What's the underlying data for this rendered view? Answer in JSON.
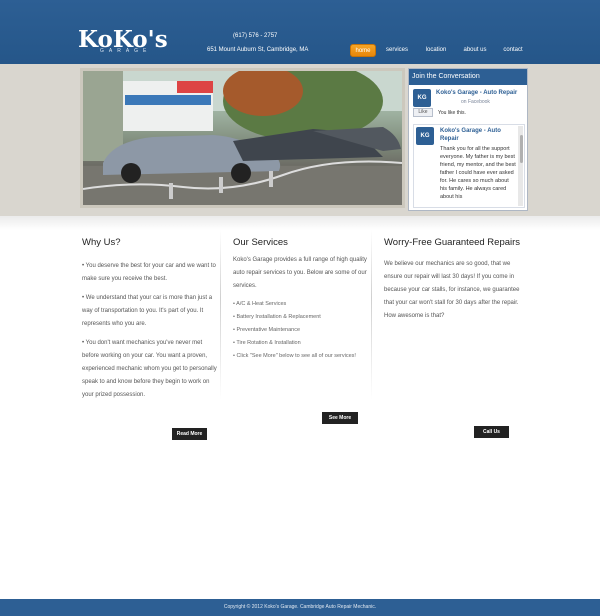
{
  "header": {
    "logo": "KoKo's",
    "logo_sub": "GARAGE",
    "phone": "(617) 576 - 2757",
    "address": "651 Mount Auburn St, Cambridge, MA",
    "nav": [
      {
        "label": "home",
        "active": true
      },
      {
        "label": "services",
        "active": false
      },
      {
        "label": "location",
        "active": false
      },
      {
        "label": "about us",
        "active": false
      },
      {
        "label": "contact",
        "active": false
      }
    ]
  },
  "facebook": {
    "title": "Join the Conversation",
    "page_name": "Koko's Garage - Auto Repair",
    "on_facebook": "on Facebook",
    "like_label": "Like",
    "likes_text": "You like this.",
    "logo_text": "KG",
    "post_author": "Koko's Garage - Auto Repair",
    "post_text": "Thank you for all the support everyone. My father is my best friend, my mentor, and the best father I could have ever asked for. He cares so much about his family. He always cared about his"
  },
  "columns": {
    "why": {
      "title": "Why Us?",
      "p1": "• You deserve the best for your car and we want to make sure you receive the best.",
      "p2": "• We understand that your car is more than just a way of transportation to you. It's part of you. It represents who you are.",
      "p3": "• You don't want mechanics you've never met before working on your car. You want a proven, experienced mechanic whom you get to personally speak to and know before they begin to work on your prized possession.",
      "button": "Read More"
    },
    "services": {
      "title": "Our Services",
      "intro": "Koko's Garage provides a full range of high quality auto repair services to you. Below are some of our services.",
      "items": [
        "• A/C & Heat Services",
        "• Battery Installation & Replacement",
        "• Preventative Maintenance",
        "• Tire Rotation & Installation",
        "• Click \"See More\" below to see all of our services!"
      ],
      "button": "See More"
    },
    "guarantee": {
      "title": "Worry-Free Guaranteed Repairs",
      "text": "We believe our mechanics are so good, that we ensure our repair will last 30 days! If you come in because your car stalls, for instance, we guarantee that your car won't stall for 30 days after the repair. How awesome is that?",
      "button": "Call Us"
    }
  },
  "footer": {
    "text": "Copyright © 2012 Koko's Garage. Cambridge Auto Repair Mechanic."
  }
}
